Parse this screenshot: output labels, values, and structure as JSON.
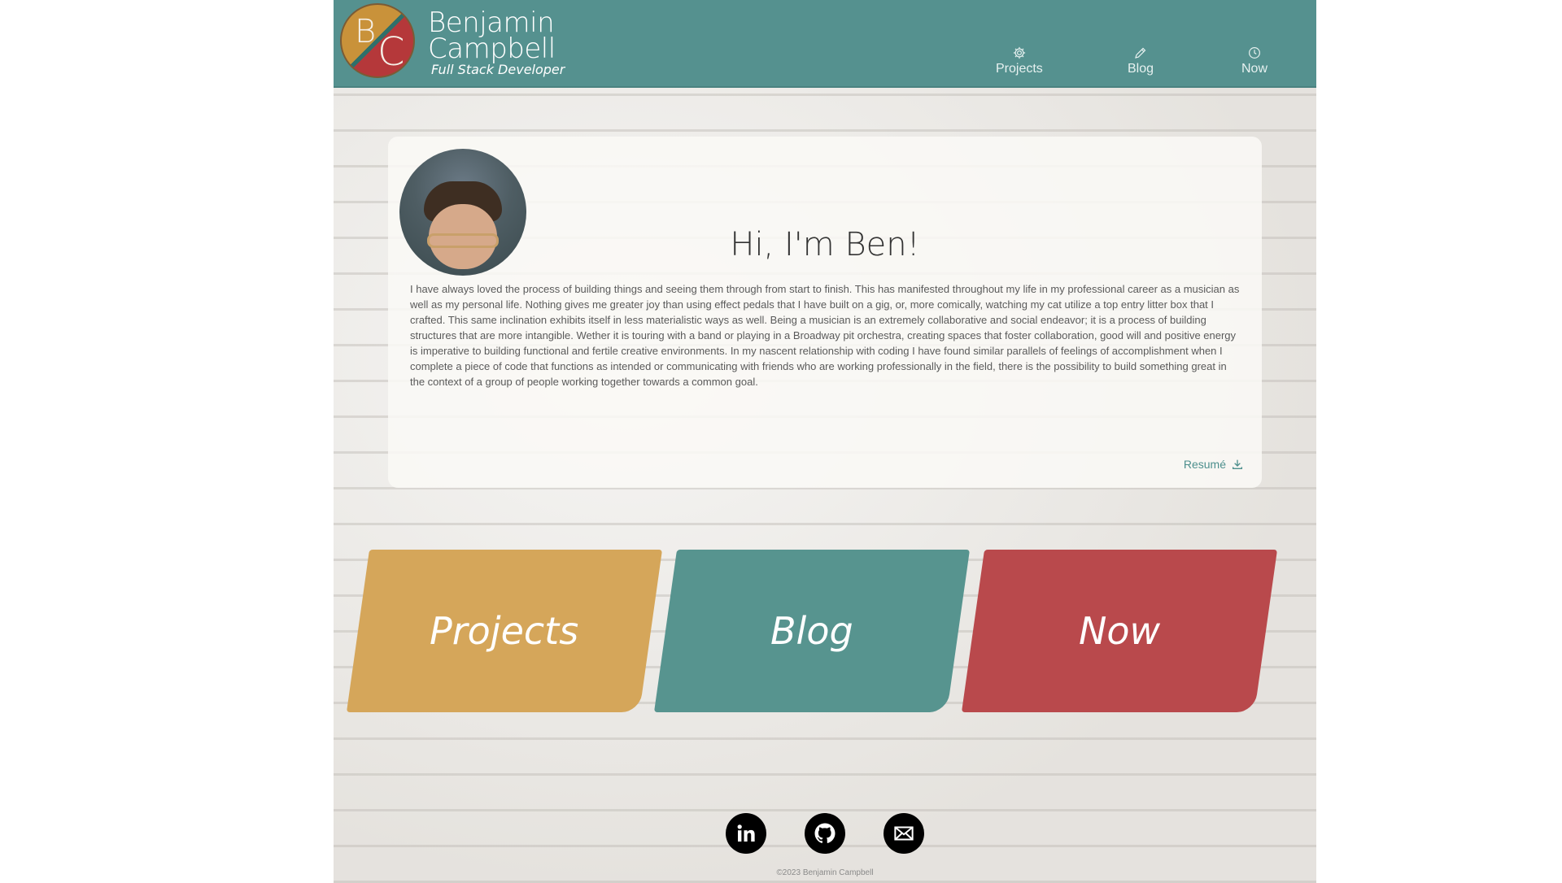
{
  "header": {
    "logo_letters": [
      "B",
      "C"
    ],
    "brand_first": "Benjamin",
    "brand_last": "Campbell",
    "subtitle": "Full Stack Developer",
    "nav": [
      {
        "label": "Projects",
        "icon": "gear-icon"
      },
      {
        "label": "Blog",
        "icon": "pencil-icon"
      },
      {
        "label": "Now",
        "icon": "clock-icon"
      }
    ],
    "color": "#55918f"
  },
  "intro": {
    "heading": "Hi, I'm Ben!",
    "body": "I have always loved the process of building things and seeing them through from start to finish. This has manifested throughout my life in my professional career as a musician as well as my personal life. Nothing gives me greater joy than using effect pedals that I have built on a gig, or, more comically, watching my cat utilize a top entry litter box that I crafted. This same inclination exhibits itself in less materialistic ways as well. Being a musician is an extremely collaborative and social endeavor; it is a process of building structures that are more intangible. Wether it is touring with a band or playing in a Broadway pit orchestra, creating spaces that foster collaboration, good will and positive energy is imperative to building functional and fertile creative environments. In my nascent relationship with coding I have found similar parallels of feelings of accomplishment when I complete a piece of code that functions as intended or communicating with friends who are working professionally in the field, there is the possibility to build something great in the context of a group of people working together towards a common goal.",
    "resume_label": "Resumé"
  },
  "tiles": [
    {
      "label": "Projects",
      "color": "#d5a65a"
    },
    {
      "label": "Blog",
      "color": "#57948f"
    },
    {
      "label": "Now",
      "color": "#b9494c"
    }
  ],
  "social": {
    "icons": [
      "linkedin-icon",
      "github-icon",
      "email-icon"
    ]
  },
  "footer": {
    "copyright": "©2023 Benjamin Campbell"
  }
}
